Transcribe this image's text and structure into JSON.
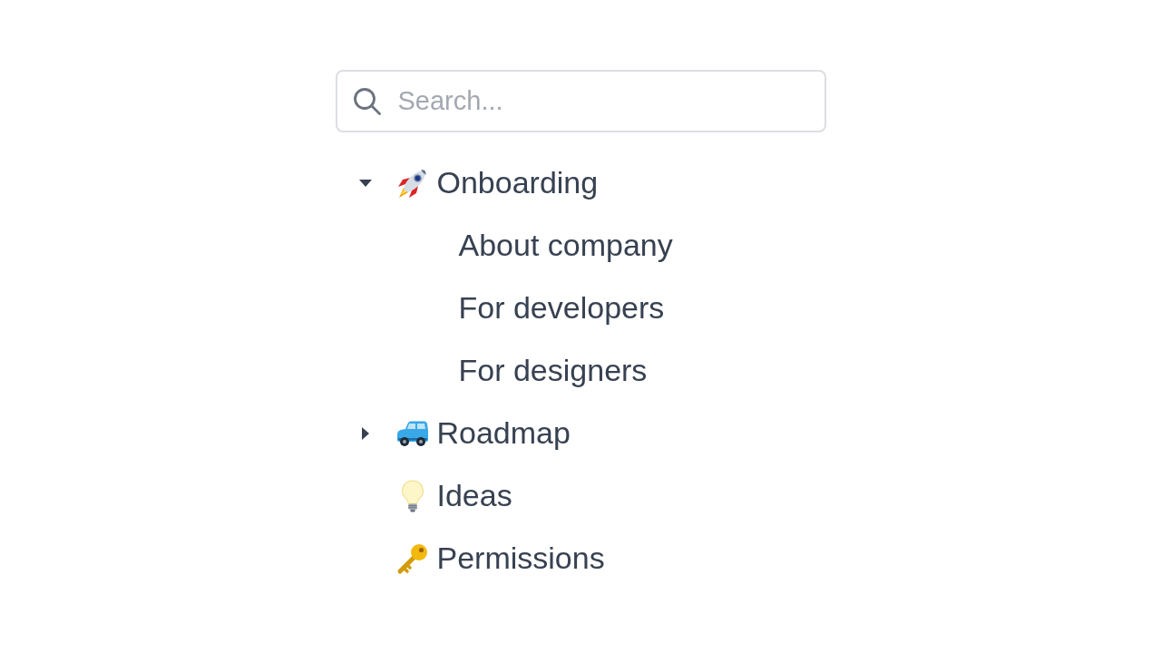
{
  "search": {
    "placeholder": "Search..."
  },
  "tree": [
    {
      "label": "Onboarding",
      "kind": "rocket",
      "expanded": true,
      "children": [
        {
          "label": "About company"
        },
        {
          "label": "For developers"
        },
        {
          "label": "For designers"
        }
      ]
    },
    {
      "label": "Roadmap",
      "kind": "car",
      "expanded": false
    },
    {
      "label": "Ideas",
      "kind": "bulb"
    },
    {
      "label": "Permissions",
      "kind": "key"
    }
  ]
}
